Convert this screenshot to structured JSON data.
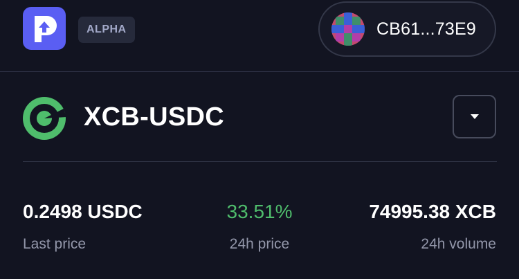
{
  "header": {
    "badge": "ALPHA",
    "wallet_address": "CB61...73E9"
  },
  "pair": {
    "name": "XCB-USDC"
  },
  "stats": [
    {
      "value": "0.2498 USDC",
      "label": "Last price"
    },
    {
      "value": "33.51%",
      "label": "24h price"
    },
    {
      "value": "74995.38 XCB",
      "label": "24h volume"
    }
  ],
  "colors": {
    "background": "#121421",
    "brand": "#5a5ef3",
    "positive": "#4fbd6c",
    "pair_icon": "#4fbd6c"
  },
  "icons": {
    "logo": "app-logo-icon",
    "avatar": "wallet-avatar-icon",
    "pair": "token-icon",
    "dropdown": "caret-down-icon"
  }
}
